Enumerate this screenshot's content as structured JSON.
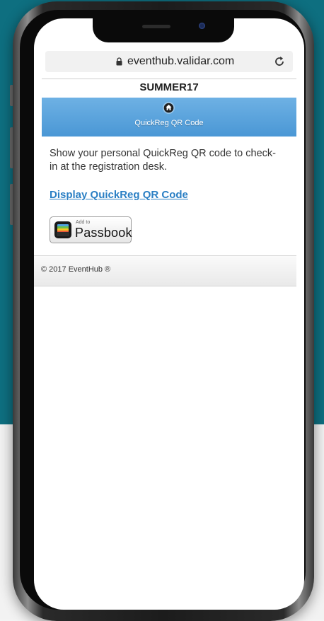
{
  "browser": {
    "url": "eventhub.validar.com"
  },
  "page": {
    "event_code": "SUMMER17",
    "banner_label": "QuickReg QR Code",
    "description": "Show your personal QuickReg QR code to check-in at the registration desk.",
    "display_link": "Display QuickReg QR Code",
    "passbook_small": "Add to",
    "passbook_big": "Passbook",
    "footer": "© 2017 EventHub ®"
  },
  "colors": {
    "background_top": "#0e6f80",
    "banner": "#5aa3dc",
    "link": "#2a7fc4"
  },
  "icons": {
    "lock": "lock-icon",
    "reload": "reload-icon",
    "home": "home-icon",
    "passbook": "passbook-icon"
  }
}
